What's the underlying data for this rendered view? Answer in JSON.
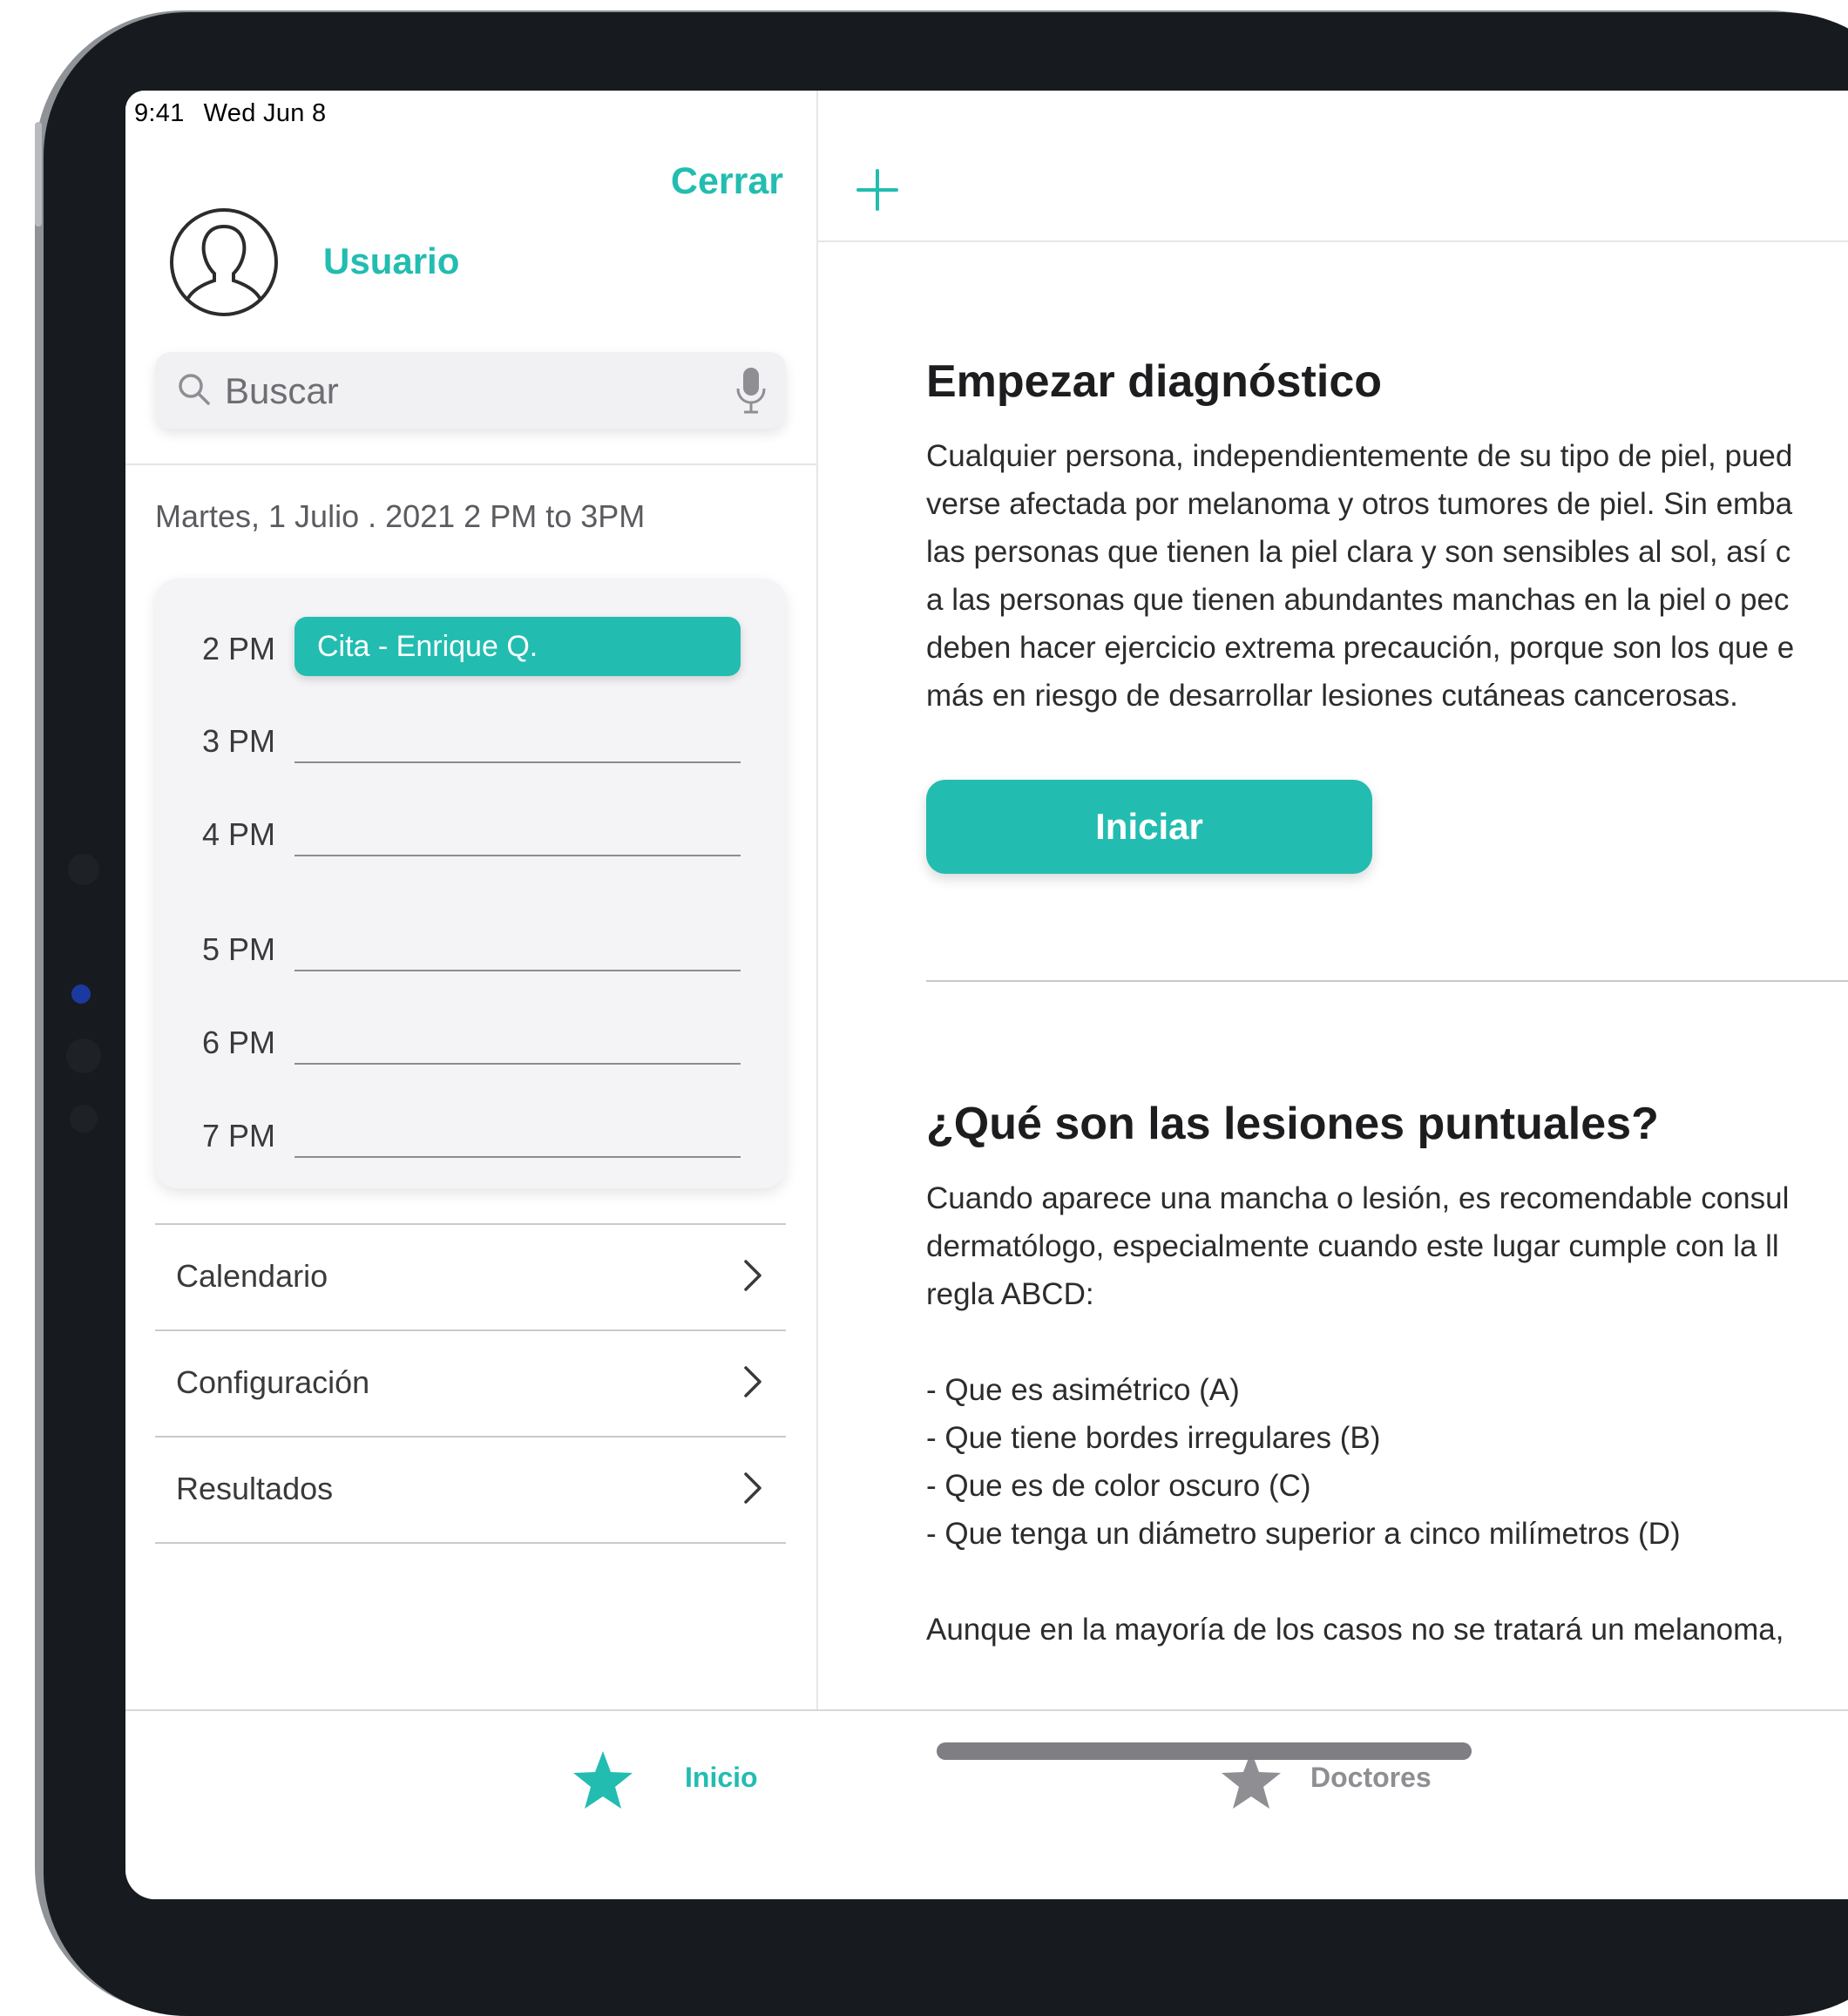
{
  "status_bar": {
    "time": "9:41",
    "date": "Wed Jun 8"
  },
  "sidebar": {
    "close_label": "Cerrar",
    "user_name": "Usuario",
    "search_placeholder": "Buscar",
    "date_range": "Martes, 1 Julio . 2021 2 PM to 3PM",
    "agenda": {
      "slots": [
        {
          "time": "2 PM",
          "appointment": "Cita - Enrique Q."
        },
        {
          "time": "3 PM",
          "appointment": ""
        },
        {
          "time": "4 PM",
          "appointment": ""
        },
        {
          "time": "5 PM",
          "appointment": ""
        },
        {
          "time": "6 PM",
          "appointment": ""
        },
        {
          "time": "7 PM",
          "appointment": ""
        }
      ]
    },
    "menu": [
      {
        "label": "Calendario"
      },
      {
        "label": "Configuración"
      },
      {
        "label": "Resultados"
      }
    ]
  },
  "main": {
    "section1": {
      "title": "Empezar diagnóstico",
      "lines": [
        "Cualquier persona, independientemente de su tipo de piel, pued",
        "verse afectada por melanoma y otros tumores de piel. Sin emba",
        "las personas que tienen la piel clara y son sensibles al sol, así c",
        "a las personas que tienen abundantes manchas en la piel o pec",
        "deben hacer ejercicio extrema precaución, porque son los que e",
        "más en riesgo de desarrollar lesiones cutáneas cancerosas."
      ],
      "button_label": "Iniciar"
    },
    "section2": {
      "title": "¿Qué son las lesiones puntuales?",
      "intro_lines": [
        "Cuando aparece una mancha o lesión, es recomendable consul",
        "dermatólogo, especialmente cuando este lugar cumple con la ll",
        "regla ABCD:"
      ],
      "list": [
        "- Que es asimétrico (A)",
        "- Que tiene bordes irregulares (B)",
        "- Que es de color oscuro (C)",
        "- Que tenga un diámetro superior a cinco milímetros (D)"
      ],
      "closing": "Aunque en la mayoría de los casos no se tratará un melanoma,"
    }
  },
  "tabbar": {
    "tabs": [
      {
        "label": "Inicio",
        "icon": "star-icon",
        "active": true
      },
      {
        "label": "Doctores",
        "icon": "star-icon",
        "active": false
      }
    ]
  },
  "colors": {
    "accent": "#22bdb0",
    "inactive": "#8e8e93",
    "device_frame": "#171a1f"
  }
}
